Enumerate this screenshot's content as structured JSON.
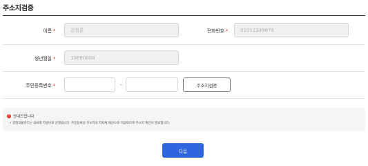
{
  "page": {
    "title": "주소지검증"
  },
  "form": {
    "name": {
      "label": "이름",
      "required_mark": "*",
      "value": "강정훈"
    },
    "phone": {
      "label": "전화번호",
      "required_mark": "*",
      "value": "01012349876"
    },
    "birth": {
      "label": "생년월일",
      "required_mark": "*",
      "value": "19880808"
    },
    "rrn": {
      "label": "주민등록번호",
      "required_mark": "*",
      "first_value": "",
      "second_value": "",
      "separator": "-"
    },
    "verify_button": "주소지검증"
  },
  "notice": {
    "icon": "info-icon",
    "title": "안내드립니다",
    "body": "• 일정교통카드는 국비와 지방비로 운영됩니다. 주민등록상 주소지의 지자체 예산으로 지급되므로 주소지 확인이 필요합니다."
  },
  "actions": {
    "next": "다음"
  },
  "colors": {
    "required": "#e2352b",
    "primary": "#2f66e0",
    "notice_bg": "#f5f5f5"
  }
}
